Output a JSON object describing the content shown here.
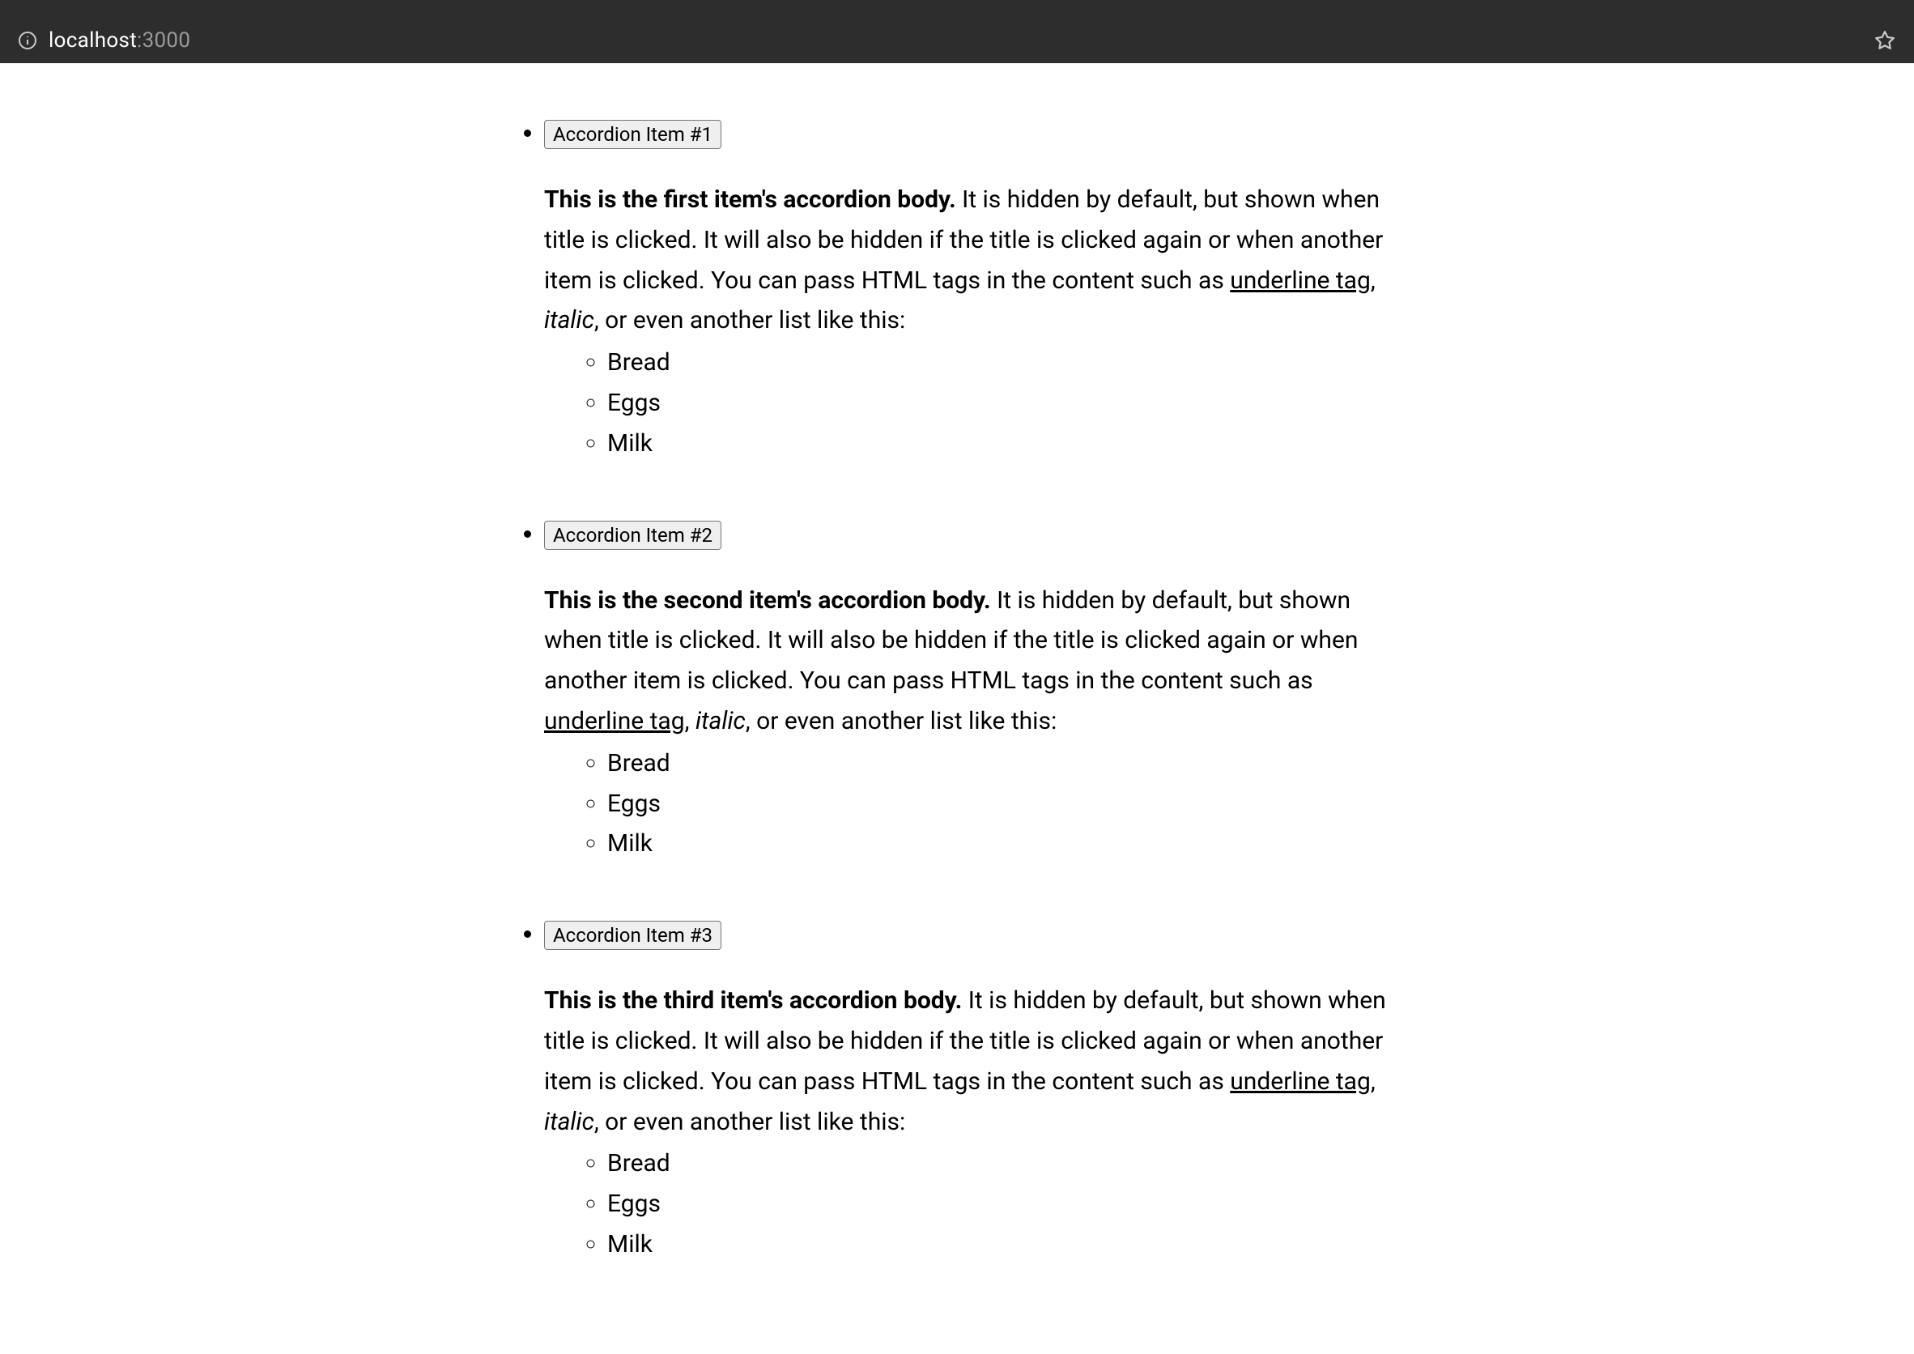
{
  "browser": {
    "url_host": "localhost",
    "url_port": ":3000"
  },
  "accordion": {
    "body_text_before_underline": " It is hidden by default, but shown when title is clicked. It will also be hidden if the title is clicked again or when another item is clicked. You can pass HTML tags in the content such as ",
    "underline_text": "underline tag",
    "sep1": ", ",
    "italic_text": "italic",
    "body_text_after_italic": ", or even another list like this:",
    "inner_items": [
      "Bread",
      "Eggs",
      "Milk"
    ],
    "items": [
      {
        "title": "Accordion Item #1",
        "strong": "This is the first item's accordion body."
      },
      {
        "title": "Accordion Item #2",
        "strong": "This is the second item's accordion body."
      },
      {
        "title": "Accordion Item #3",
        "strong": "This is the third item's accordion body."
      }
    ]
  }
}
